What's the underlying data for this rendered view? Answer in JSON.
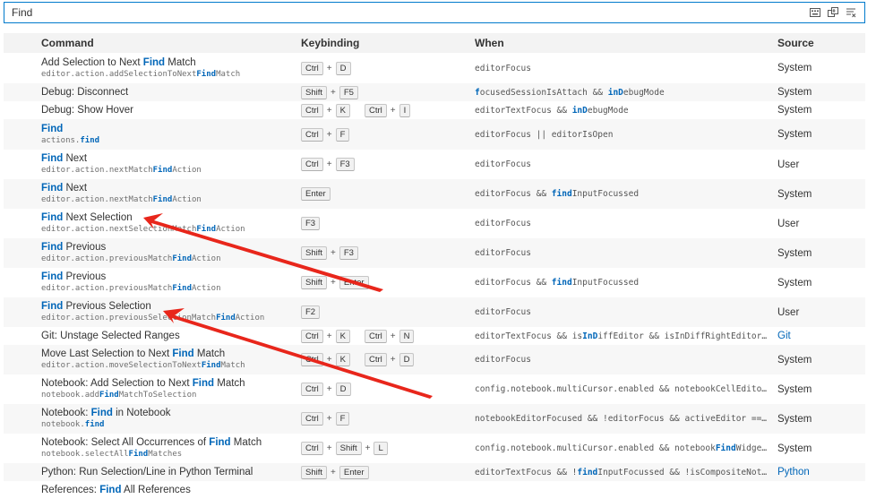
{
  "search": {
    "value": "Find",
    "placeholder": ""
  },
  "columns": {
    "command": "Command",
    "keybinding": "Keybinding",
    "when": "When",
    "source": "Source"
  },
  "rows": [
    {
      "title": [
        [
          "Add Selection to Next ",
          0
        ],
        [
          "Find",
          1
        ],
        [
          " Match",
          0
        ]
      ],
      "id": [
        [
          "editor.action.addSelectionToNext",
          0
        ],
        [
          "Find",
          1
        ],
        [
          "Match",
          0
        ]
      ],
      "keys": [
        [
          "Ctrl",
          "D"
        ]
      ],
      "when": [
        [
          "editorFocus",
          0
        ]
      ],
      "source": "System",
      "sourceLink": false
    },
    {
      "title": [
        [
          "Debug: Disconnect",
          0
        ]
      ],
      "id": [],
      "keys": [
        [
          "Shift",
          "F5"
        ]
      ],
      "when": [
        [
          "f",
          1
        ],
        [
          "ocusedSessionIsAttach && ",
          0
        ],
        [
          "inD",
          1
        ],
        [
          "ebugMode",
          0
        ]
      ],
      "source": "System",
      "sourceLink": false
    },
    {
      "title": [
        [
          "Debug: Show Hover",
          0
        ]
      ],
      "id": [],
      "keys": [
        [
          "Ctrl",
          "K"
        ],
        [
          "Ctrl",
          "I"
        ]
      ],
      "when": [
        [
          "editorTextF",
          0
        ],
        [
          "ocus",
          0
        ],
        [
          " && ",
          0
        ],
        [
          "inD",
          1
        ],
        [
          "ebugMode",
          0
        ]
      ],
      "source": "System",
      "sourceLink": false
    },
    {
      "title": [
        [
          "Find",
          1
        ]
      ],
      "id": [
        [
          "actions.",
          0
        ],
        [
          "find",
          1
        ]
      ],
      "keys": [
        [
          "Ctrl",
          "F"
        ]
      ],
      "when": [
        [
          "editorFocus || editorIsOpen",
          0
        ]
      ],
      "source": "System",
      "sourceLink": false
    },
    {
      "title": [
        [
          "Find",
          1
        ],
        [
          " Next",
          0
        ]
      ],
      "id": [
        [
          "editor.action.nextMatch",
          0
        ],
        [
          "Find",
          1
        ],
        [
          "Action",
          0
        ]
      ],
      "keys": [
        [
          "Ctrl",
          "F3"
        ]
      ],
      "when": [
        [
          "editorFocus",
          0
        ]
      ],
      "source": "User",
      "sourceLink": false
    },
    {
      "title": [
        [
          "Find",
          1
        ],
        [
          " Next",
          0
        ]
      ],
      "id": [
        [
          "editor.action.nextMatch",
          0
        ],
        [
          "Find",
          1
        ],
        [
          "Action",
          0
        ]
      ],
      "keys": [
        [
          "Enter"
        ]
      ],
      "when": [
        [
          "editorFocus && ",
          0
        ],
        [
          "find",
          1
        ],
        [
          "InputFocussed",
          0
        ]
      ],
      "source": "System",
      "sourceLink": false
    },
    {
      "title": [
        [
          "Find",
          1
        ],
        [
          " Next Selection",
          0
        ]
      ],
      "id": [
        [
          "editor.action.nextSelectionMatch",
          0
        ],
        [
          "Find",
          1
        ],
        [
          "Action",
          0
        ]
      ],
      "keys": [
        [
          "F3"
        ]
      ],
      "when": [
        [
          "editorFocus",
          0
        ]
      ],
      "source": "User",
      "sourceLink": false
    },
    {
      "title": [
        [
          "Find",
          1
        ],
        [
          " Previous",
          0
        ]
      ],
      "id": [
        [
          "editor.action.previousMatch",
          0
        ],
        [
          "Find",
          1
        ],
        [
          "Action",
          0
        ]
      ],
      "keys": [
        [
          "Shift",
          "F3"
        ]
      ],
      "when": [
        [
          "editorFocus",
          0
        ]
      ],
      "source": "System",
      "sourceLink": false
    },
    {
      "title": [
        [
          "Find",
          1
        ],
        [
          " Previous",
          0
        ]
      ],
      "id": [
        [
          "editor.action.previousMatch",
          0
        ],
        [
          "Find",
          1
        ],
        [
          "Action",
          0
        ]
      ],
      "keys": [
        [
          "Shift",
          "Enter"
        ]
      ],
      "when": [
        [
          "editorFocus && ",
          0
        ],
        [
          "find",
          1
        ],
        [
          "InputFocussed",
          0
        ]
      ],
      "source": "System",
      "sourceLink": false
    },
    {
      "title": [
        [
          "Find",
          1
        ],
        [
          " Previous Selection",
          0
        ]
      ],
      "id": [
        [
          "editor.action.previousSelectionMatch",
          0
        ],
        [
          "Find",
          1
        ],
        [
          "Action",
          0
        ]
      ],
      "keys": [
        [
          "F2"
        ]
      ],
      "when": [
        [
          "editorFocus",
          0
        ]
      ],
      "source": "User",
      "sourceLink": false
    },
    {
      "title": [
        [
          "Git: Unstage Selected Ranges",
          0
        ]
      ],
      "id": [],
      "keys": [
        [
          "Ctrl",
          "K"
        ],
        [
          "Ctrl",
          "N"
        ]
      ],
      "when": [
        [
          "editorTextF",
          0
        ],
        [
          "ocus",
          0
        ],
        [
          " && is",
          0
        ],
        [
          "InD",
          1
        ],
        [
          "iffEditor && isInDiffRightEditor && ...",
          0
        ]
      ],
      "source": "Git",
      "sourceLink": true
    },
    {
      "title": [
        [
          "Move Last Selection to Next ",
          0
        ],
        [
          "Find",
          1
        ],
        [
          " Match",
          0
        ]
      ],
      "id": [
        [
          "editor.action.moveSelectionToNext",
          0
        ],
        [
          "Find",
          1
        ],
        [
          "Match",
          0
        ]
      ],
      "keys": [
        [
          "Ctrl",
          "K"
        ],
        [
          "Ctrl",
          "D"
        ]
      ],
      "when": [
        [
          "editorFocus",
          0
        ]
      ],
      "source": "System",
      "sourceLink": false
    },
    {
      "title": [
        [
          "Notebook: Add Selection to Next ",
          0
        ],
        [
          "Find",
          1
        ],
        [
          " Match",
          0
        ]
      ],
      "id": [
        [
          "notebook.add",
          0
        ],
        [
          "Find",
          1
        ],
        [
          "MatchToSelection",
          0
        ]
      ],
      "keys": [
        [
          "Ctrl",
          "D"
        ]
      ],
      "when": [
        [
          "config.notebook.multiCursor.enabled && notebookCellEditorFoc...",
          0
        ]
      ],
      "source": "System",
      "sourceLink": false
    },
    {
      "title": [
        [
          "Notebook: ",
          0
        ],
        [
          "Find",
          1
        ],
        [
          " in Notebook",
          0
        ]
      ],
      "id": [
        [
          "notebook.",
          0
        ],
        [
          "find",
          1
        ]
      ],
      "keys": [
        [
          "Ctrl",
          "F"
        ]
      ],
      "when": [
        [
          "notebookEditorFocused && !editorFocus && activeEditor == 'wo...",
          0
        ]
      ],
      "source": "System",
      "sourceLink": false
    },
    {
      "title": [
        [
          "Notebook: Select All Occurrences of ",
          0
        ],
        [
          "Find",
          1
        ],
        [
          " Match",
          0
        ]
      ],
      "id": [
        [
          "notebook.selectAll",
          0
        ],
        [
          "Find",
          1
        ],
        [
          "Matches",
          0
        ]
      ],
      "keys": [
        [
          "Ctrl",
          "Shift",
          "L"
        ]
      ],
      "when": [
        [
          "config.notebook.multiCursor.enabled && notebook",
          0
        ],
        [
          "Find",
          1
        ],
        [
          "WidgetFoc...",
          0
        ]
      ],
      "source": "System",
      "sourceLink": false
    },
    {
      "title": [
        [
          "Python: Run Selection/Line in Python Terminal",
          0
        ]
      ],
      "id": [],
      "keys": [
        [
          "Shift",
          "Enter"
        ]
      ],
      "when": [
        [
          "editorTextFocus && !",
          0
        ],
        [
          "find",
          1
        ],
        [
          "InputFocussed && !isCompositeNoteboo...",
          0
        ]
      ],
      "source": "Python",
      "sourceLink": true
    },
    {
      "title": [
        [
          "References: ",
          0
        ],
        [
          "Find",
          1
        ],
        [
          " All References",
          0
        ]
      ],
      "id": [],
      "keys": [],
      "when": [],
      "source": "",
      "sourceLink": false
    }
  ],
  "colors": {
    "accent": "#007acc",
    "highlight": "#0066b8",
    "arrow": "#e8261b"
  },
  "icons": [
    "record-keys-icon",
    "sort-by-precedence-icon",
    "clear-filter-icon"
  ]
}
